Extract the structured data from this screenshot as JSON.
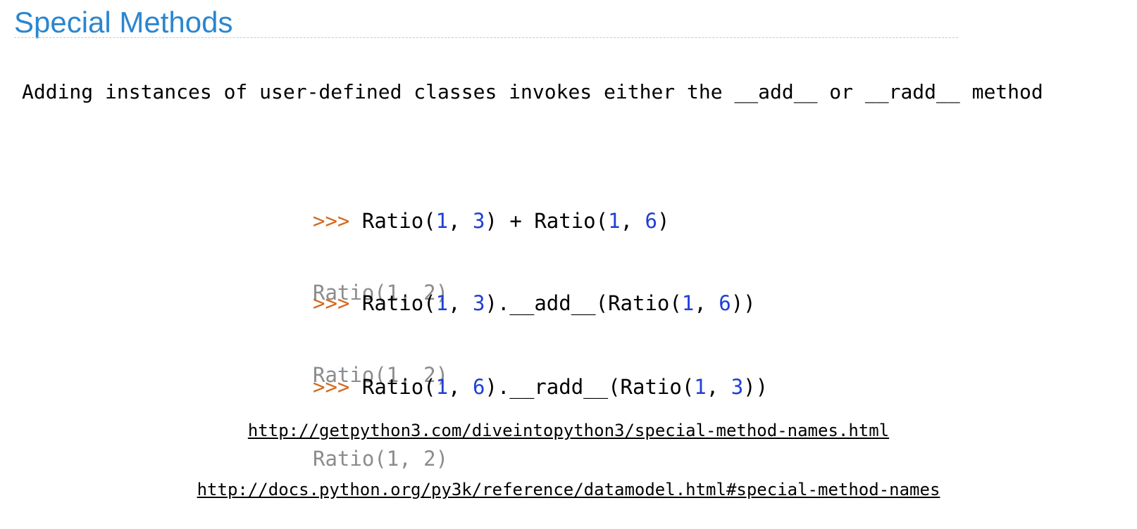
{
  "title": "Special Methods",
  "intro": "Adding instances of user-defined classes invokes either the __add__ or __radd__ method",
  "examples": [
    {
      "prompt": ">>>",
      "input_parts": [
        {
          "text": "Ratio(",
          "kind": "plain"
        },
        {
          "text": "1",
          "kind": "num"
        },
        {
          "text": ", ",
          "kind": "plain"
        },
        {
          "text": "3",
          "kind": "num"
        },
        {
          "text": ") + Ratio(",
          "kind": "plain"
        },
        {
          "text": "1",
          "kind": "num"
        },
        {
          "text": ", ",
          "kind": "plain"
        },
        {
          "text": "6",
          "kind": "num"
        },
        {
          "text": ")",
          "kind": "plain"
        }
      ],
      "output": "Ratio(1, 2)"
    },
    {
      "prompt": ">>>",
      "input_parts": [
        {
          "text": "Ratio(",
          "kind": "plain"
        },
        {
          "text": "1",
          "kind": "num"
        },
        {
          "text": ", ",
          "kind": "plain"
        },
        {
          "text": "3",
          "kind": "num"
        },
        {
          "text": ").__add__(Ratio(",
          "kind": "plain"
        },
        {
          "text": "1",
          "kind": "num"
        },
        {
          "text": ", ",
          "kind": "plain"
        },
        {
          "text": "6",
          "kind": "num"
        },
        {
          "text": "))",
          "kind": "plain"
        }
      ],
      "output": "Ratio(1, 2)"
    },
    {
      "prompt": ">>>",
      "input_parts": [
        {
          "text": "Ratio(",
          "kind": "plain"
        },
        {
          "text": "1",
          "kind": "num"
        },
        {
          "text": ", ",
          "kind": "plain"
        },
        {
          "text": "6",
          "kind": "num"
        },
        {
          "text": ").__radd__(Ratio(",
          "kind": "plain"
        },
        {
          "text": "1",
          "kind": "num"
        },
        {
          "text": ", ",
          "kind": "plain"
        },
        {
          "text": "3",
          "kind": "num"
        },
        {
          "text": "))",
          "kind": "plain"
        }
      ],
      "output": "Ratio(1, 2)"
    }
  ],
  "links": [
    "http://getpython3.com/diveintopython3/special-method-names.html",
    "http://docs.python.org/py3k/reference/datamodel.html#special-method-names"
  ],
  "colors": {
    "title": "#2a86d0",
    "prompt": "#d2691e",
    "number": "#1f3fd6",
    "output": "#8c8c8c"
  }
}
